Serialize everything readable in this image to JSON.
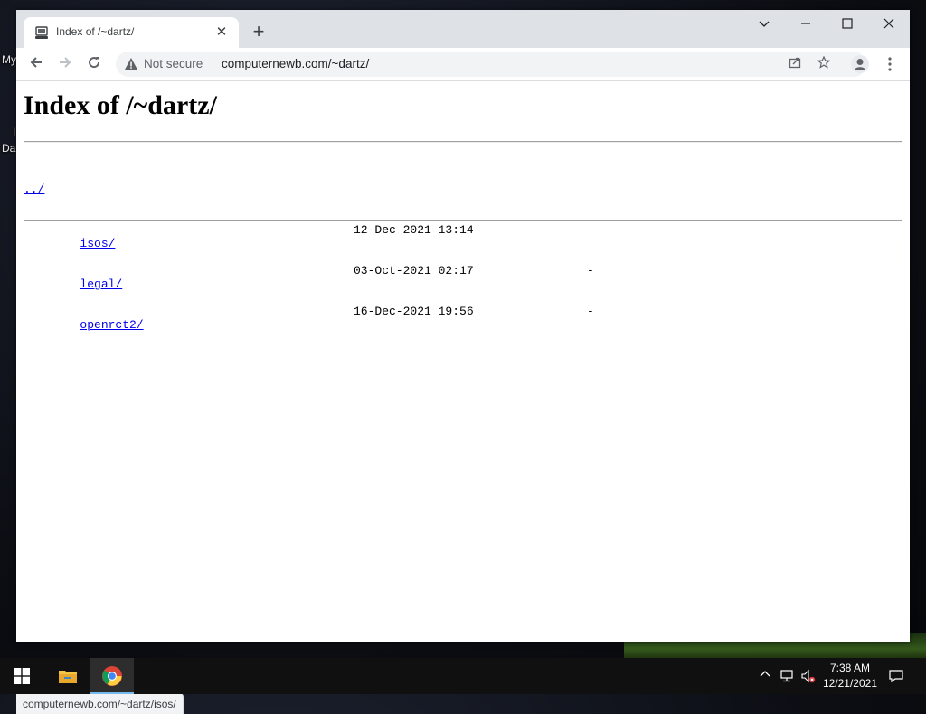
{
  "desktop": {
    "labels": [
      "My",
      "I",
      "Da"
    ]
  },
  "browser": {
    "tab": {
      "title": "Index of /~dartz/"
    },
    "omnibox": {
      "security_label": "Not secure",
      "url": "computernewb.com/~dartz/"
    },
    "status_url": "computernewb.com/~dartz/isos/"
  },
  "page": {
    "heading": "Index of /~dartz/",
    "parent_link": "../",
    "entries": [
      {
        "name": "isos/",
        "date": "12-Dec-2021 13:14",
        "size": "-"
      },
      {
        "name": "legal/",
        "date": "03-Oct-2021 02:17",
        "size": "-"
      },
      {
        "name": "openrct2/",
        "date": "16-Dec-2021 19:56",
        "size": "-"
      }
    ]
  },
  "taskbar": {
    "time": "7:38 AM",
    "date": "12/21/2021",
    "active_app": "chrome-icon"
  },
  "colors": {
    "link": "#0000ee",
    "tabstrip": "#dee1e6",
    "taskbar": "#101010"
  }
}
